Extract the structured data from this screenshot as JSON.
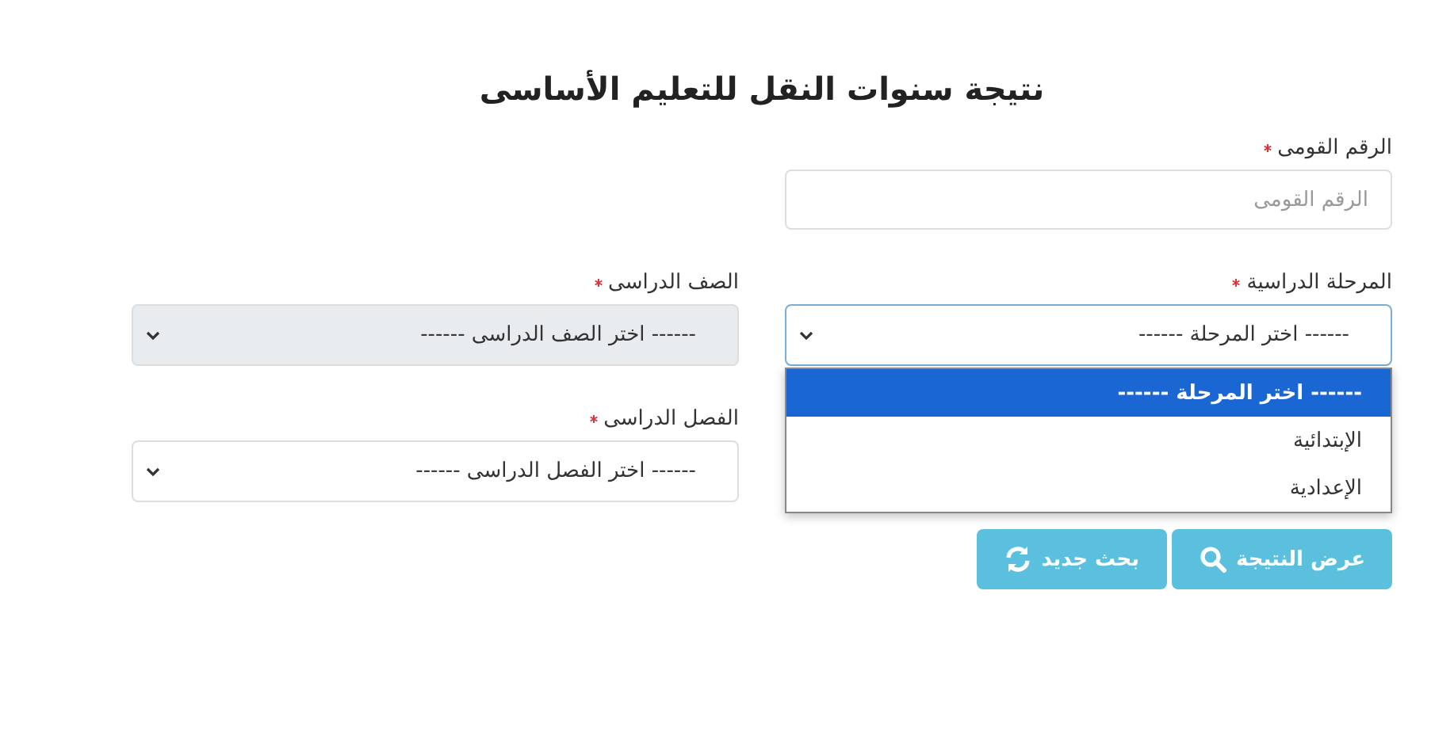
{
  "title": "نتيجة سنوات النقل للتعليم الأساسى",
  "fields": [
    {
      "kind": "text",
      "label": "الرقم القومى",
      "required": true,
      "placeholder": "الرقم القومى"
    },
    {
      "kind": "select",
      "label": "المرحلة الدراسية",
      "required": true,
      "value": "------ اختر المرحلة ------",
      "disabled": false,
      "expanded": true,
      "options": [
        {
          "label": "------ اختر المرحلة ------",
          "selected": true
        },
        {
          "label": "الإبتدائية",
          "selected": false
        },
        {
          "label": "الإعدادية",
          "selected": false
        }
      ]
    },
    {
      "kind": "select",
      "label": "الصف الدراسى",
      "required": true,
      "value": "------ اختر الصف الدراسى ------",
      "disabled": true,
      "expanded": false
    },
    {
      "kind": "select",
      "label": "الفصل الدراسى",
      "required": true,
      "value": "------ اختر الفصل الدراسى ------",
      "disabled": false,
      "expanded": false
    }
  ],
  "buttons": [
    {
      "kind": "search",
      "label": "عرض النتيجة"
    },
    {
      "kind": "reset",
      "label": "بحث جديد"
    }
  ]
}
